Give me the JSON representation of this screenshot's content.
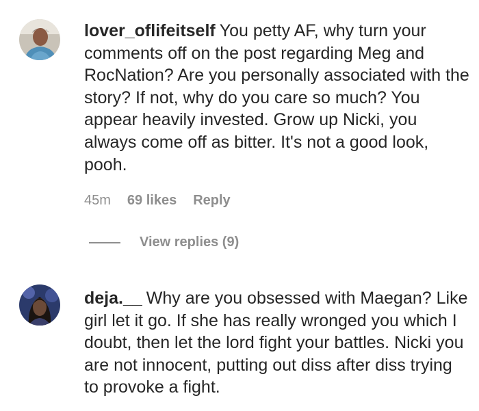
{
  "comments": [
    {
      "username": "lover_oflifeitself",
      "text": "You petty AF, why turn your comments off on the post regarding Meg and RocNation? Are you personally associated with the story? If not, why do you care so much? You appear heavily invested. Grow up Nicki, you always come off as bitter. It's not a good look, pooh.",
      "time": "45m",
      "likes": "69 likes",
      "reply_label": "Reply",
      "view_replies": "View replies (9)"
    },
    {
      "username": "deja.__",
      "text": "Why are you obsessed with Maegan? Like girl let it go. If she has really wronged you which I doubt, then let the lord fight your battles. Nicki you are not innocent, putting out diss after diss trying to provoke a fight."
    }
  ]
}
